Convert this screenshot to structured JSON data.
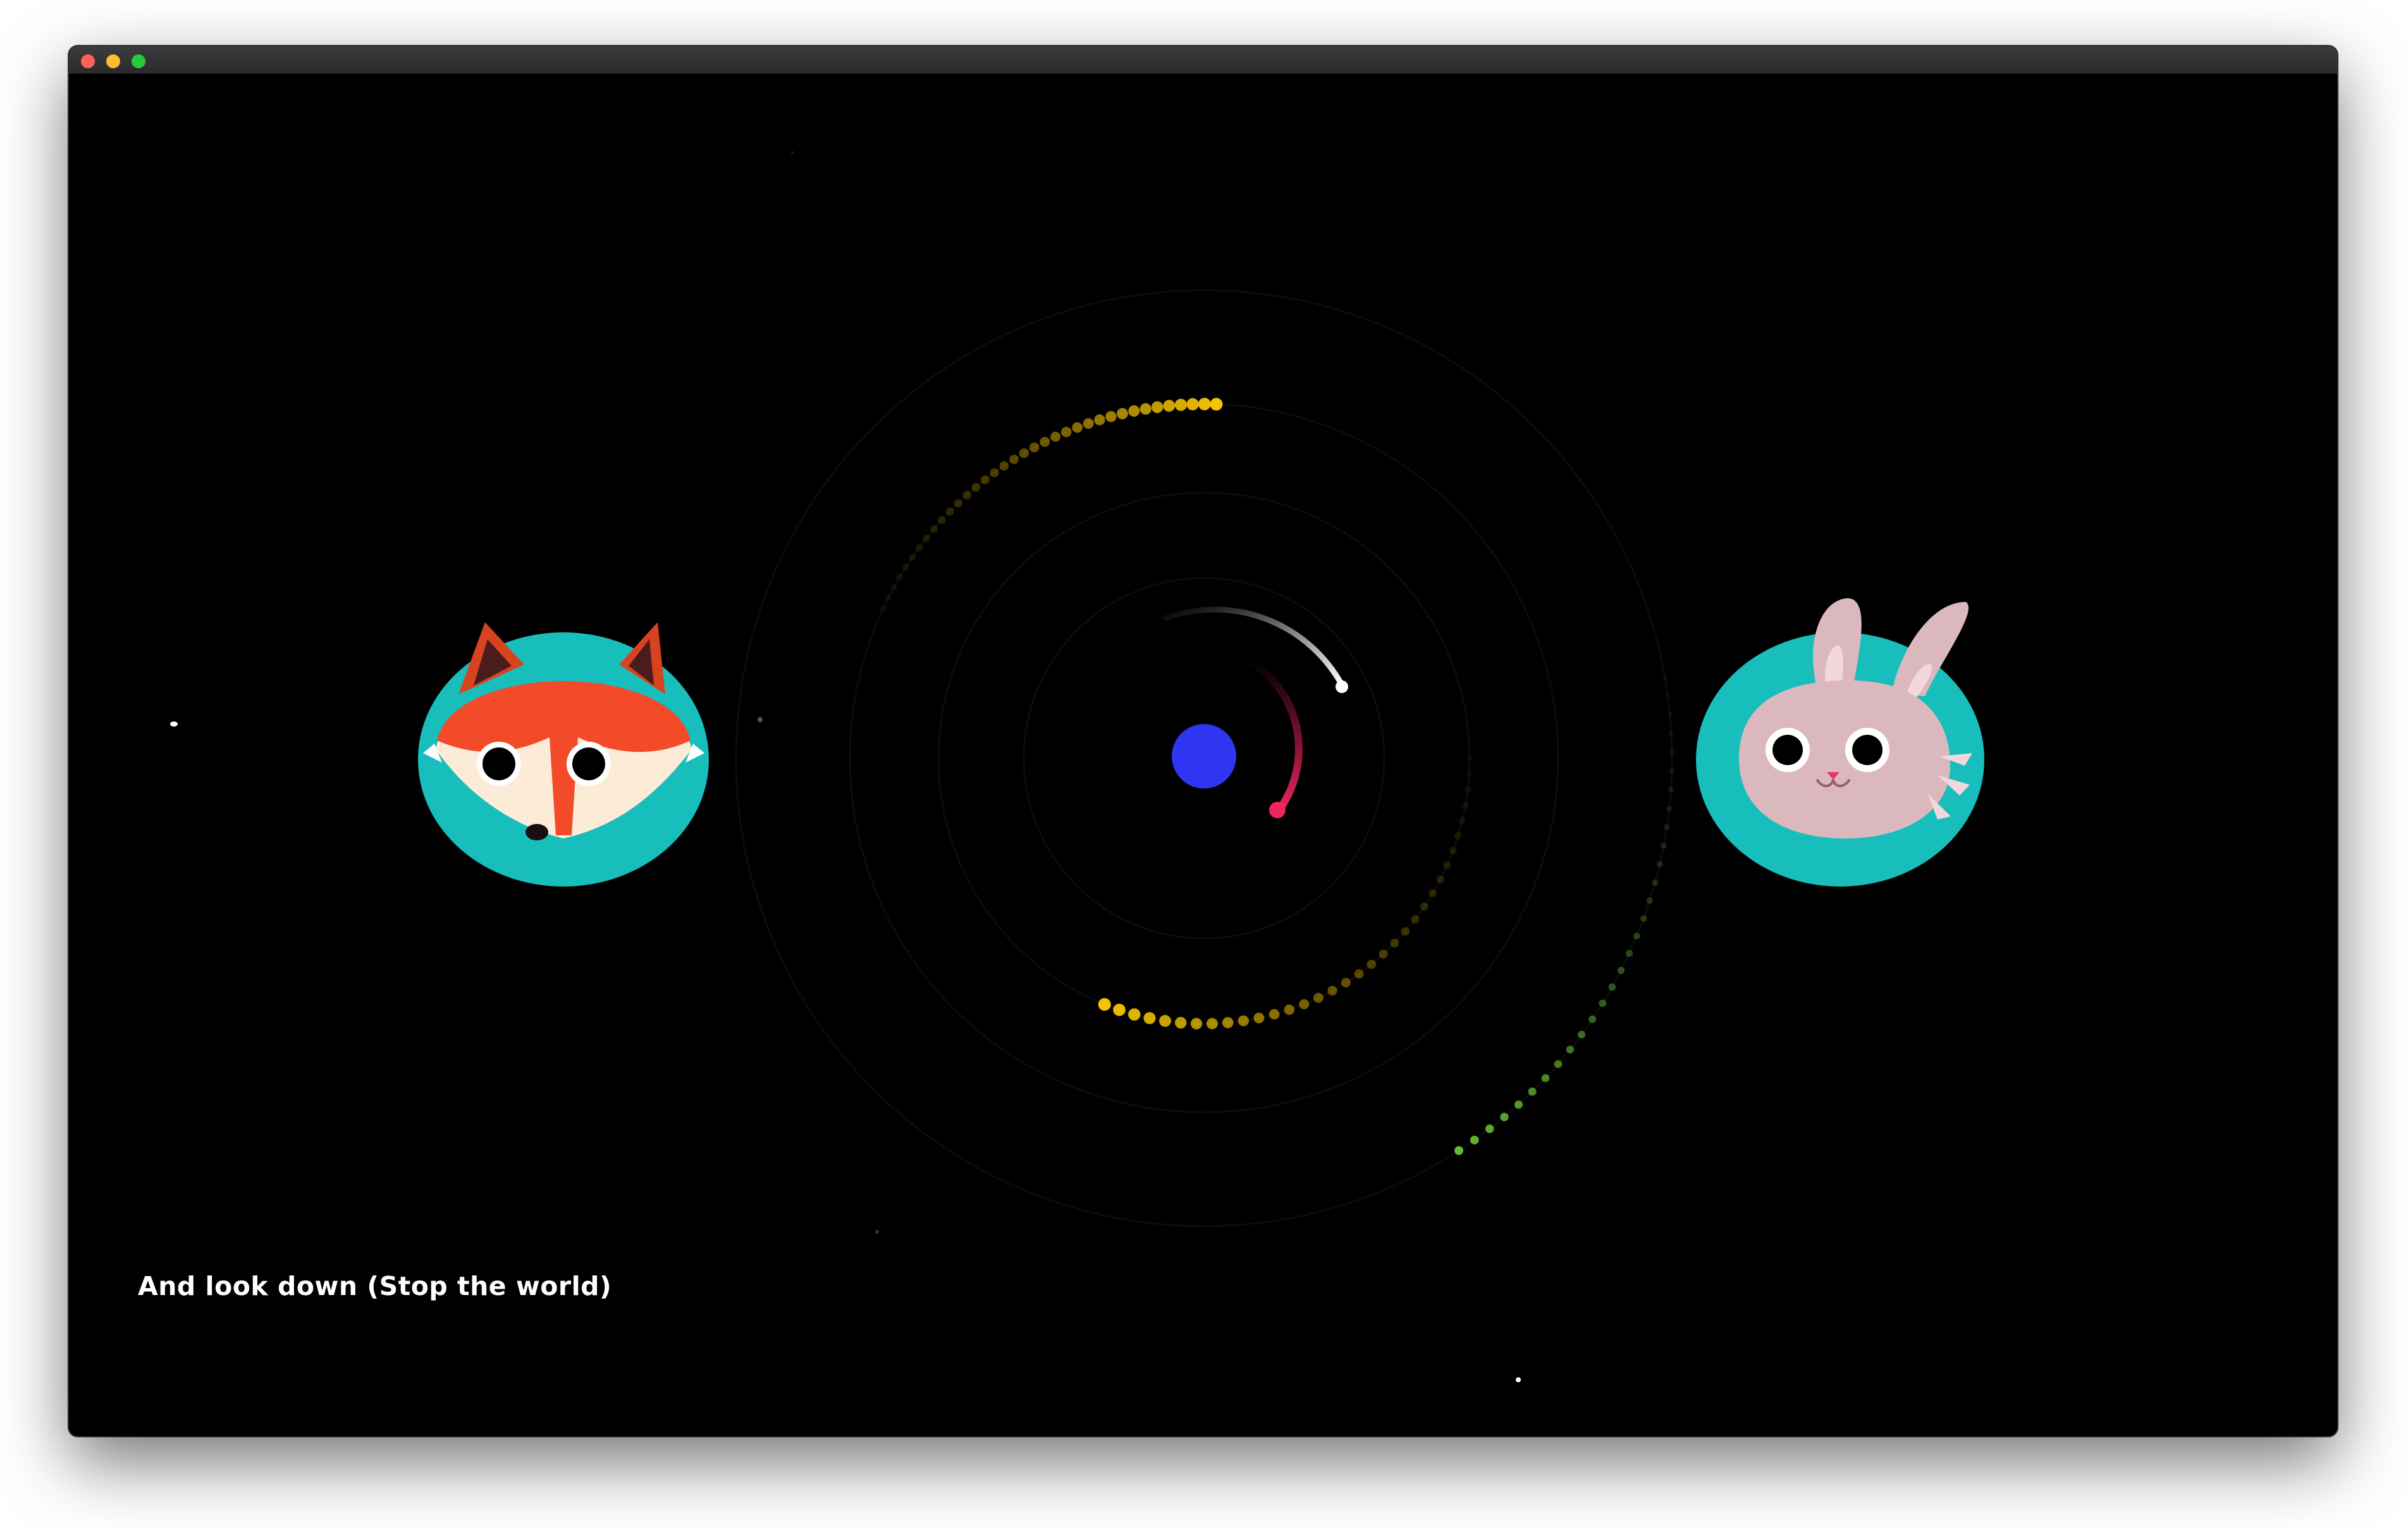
{
  "window": {
    "controls": [
      "close",
      "minimize",
      "maximize"
    ]
  },
  "caption": {
    "text": "And look down (Stop the world)"
  },
  "scene": {
    "left_character": "fox-icon",
    "right_character": "bunny-icon",
    "center": "planet-icon",
    "colors": {
      "background": "#000000",
      "teal": "#17BEBB",
      "fox_orange": "#F34A2A",
      "fox_cream": "#FCEBD7",
      "bunny_pink": "#DBB8BE",
      "planet_blue": "#2F36F2",
      "orbit_yellow": "#F5C400",
      "orbit_green": "#68B832",
      "orbit_white": "#FFFFFF",
      "orbit_red": "#F0245E"
    }
  }
}
